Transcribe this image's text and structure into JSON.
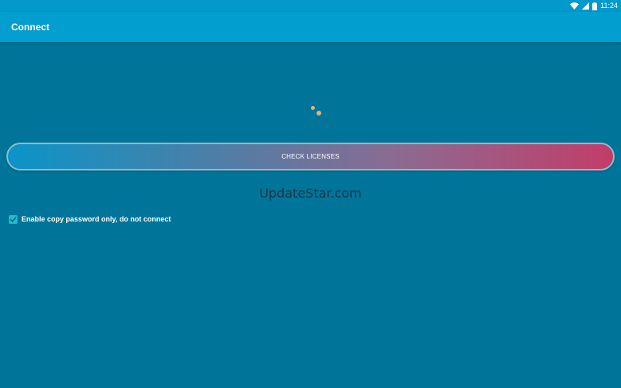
{
  "status_bar": {
    "time": "11:24",
    "icons": [
      "wifi-icon",
      "signal-icon",
      "battery-icon"
    ]
  },
  "app_bar": {
    "title": "Connect"
  },
  "main": {
    "loading": true,
    "check_licenses_label": "CHECK LICENSES",
    "watermark": "UpdateStar.com",
    "copy_password_option": {
      "label": "Enable copy password only, do not connect",
      "checked": true
    }
  },
  "colors": {
    "background": "#017599",
    "app_bar": "#029ecf",
    "status_bar": "#0299cb",
    "button_gradient_start": "#0a94c8",
    "button_gradient_end": "#c23d68",
    "checkbox": "#26b6d0",
    "spinner": "#e0b37a"
  }
}
